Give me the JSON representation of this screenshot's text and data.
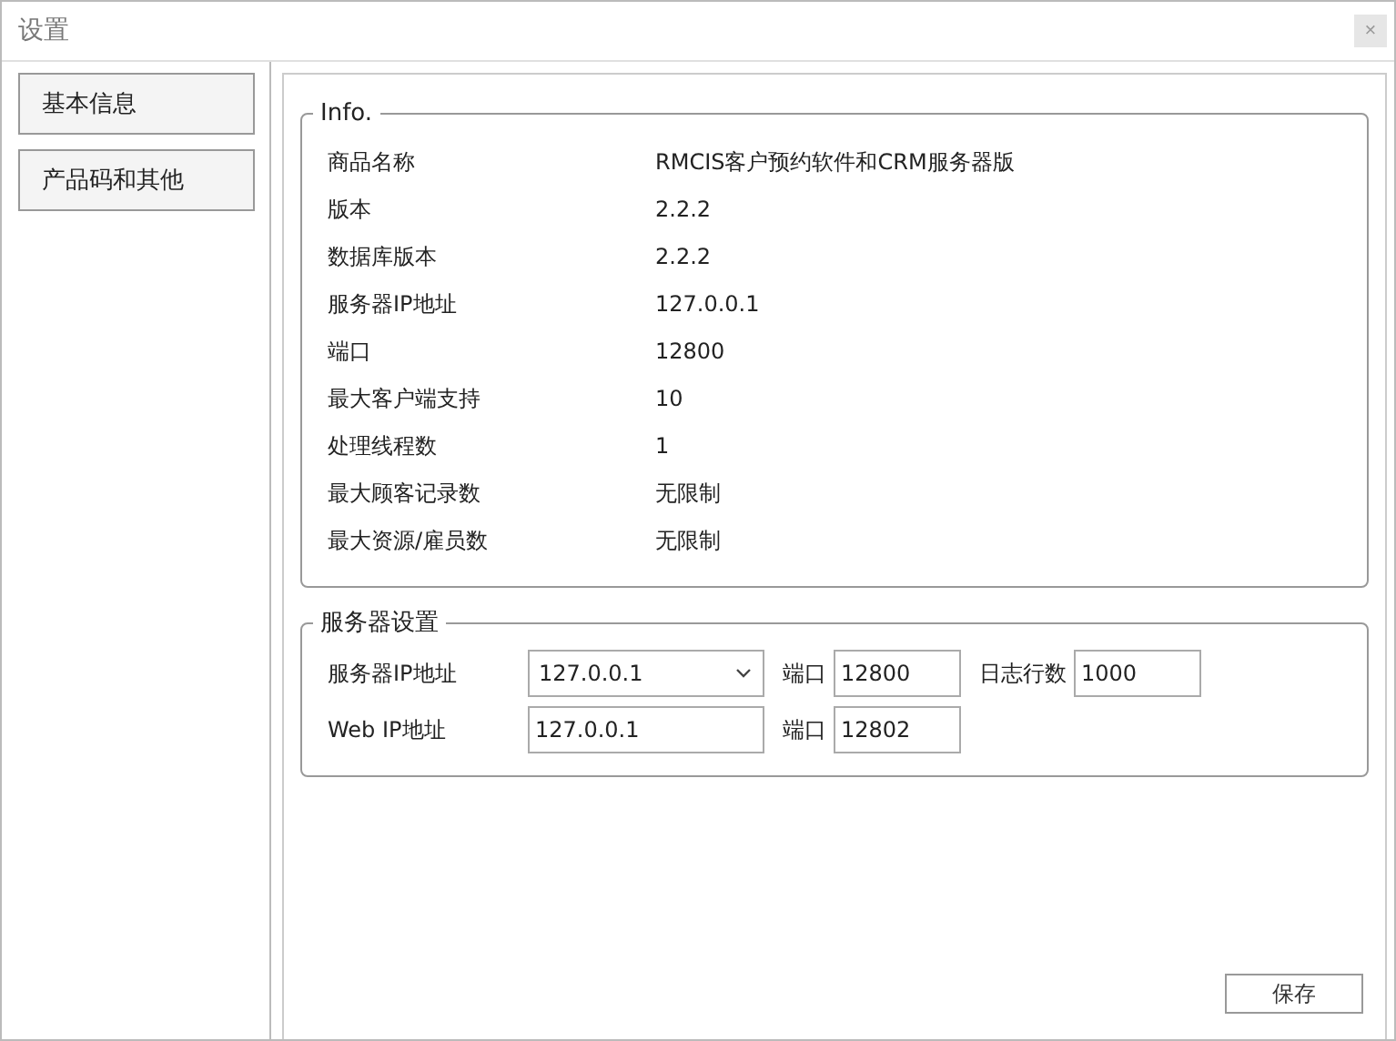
{
  "window": {
    "title": "设置",
    "close": "×"
  },
  "sidebar": {
    "items": [
      {
        "label": "基本信息"
      },
      {
        "label": "产品码和其他"
      }
    ]
  },
  "info": {
    "legend": "Info.",
    "rows": [
      {
        "label": "商品名称",
        "value": "RMCIS客户预约软件和CRM服务器版"
      },
      {
        "label": "版本",
        "value": "2.2.2"
      },
      {
        "label": "数据库版本",
        "value": "2.2.2"
      },
      {
        "label": "服务器IP地址",
        "value": "127.0.0.1"
      },
      {
        "label": "端口",
        "value": "12800"
      },
      {
        "label": "最大客户端支持",
        "value": "10"
      },
      {
        "label": "处理线程数",
        "value": "1"
      },
      {
        "label": "最大顾客记录数",
        "value": "无限制"
      },
      {
        "label": "最大资源/雇员数",
        "value": "无限制"
      }
    ]
  },
  "server_settings": {
    "legend": "服务器设置",
    "server_ip": {
      "label": "服务器IP地址",
      "value": "127.0.0.1"
    },
    "server_port": {
      "label": "端口",
      "value": "12800"
    },
    "log_lines": {
      "label": "日志行数",
      "value": "1000"
    },
    "web_ip": {
      "label": "Web IP地址",
      "value": "127.0.0.1"
    },
    "web_port": {
      "label": "端口",
      "value": "12802"
    }
  },
  "save_button": "保存"
}
